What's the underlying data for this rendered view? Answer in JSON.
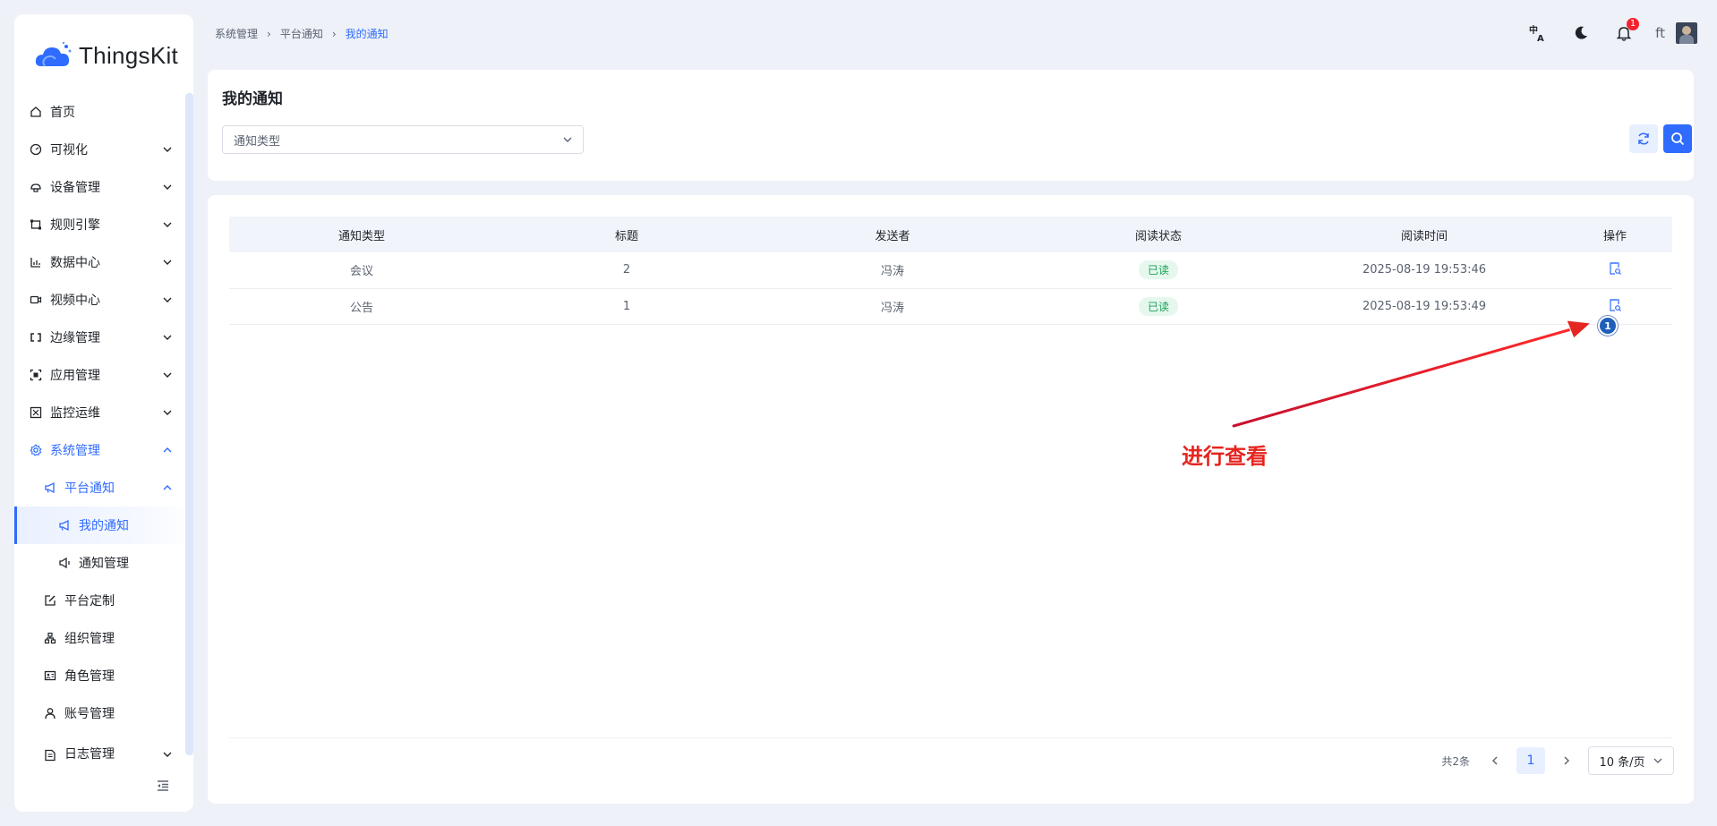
{
  "app": {
    "logo_text": "ThingsKit"
  },
  "sidebar": {
    "items": [
      {
        "label": "首页",
        "icon": "home-icon"
      },
      {
        "label": "可视化",
        "icon": "dashboard-icon"
      },
      {
        "label": "设备管理",
        "icon": "device-icon"
      },
      {
        "label": "规则引擎",
        "icon": "rule-icon"
      },
      {
        "label": "数据中心",
        "icon": "chart-icon"
      },
      {
        "label": "视频中心",
        "icon": "video-icon"
      },
      {
        "label": "边缘管理",
        "icon": "edge-icon"
      },
      {
        "label": "应用管理",
        "icon": "app-icon"
      },
      {
        "label": "监控运维",
        "icon": "monitor-icon"
      },
      {
        "label": "系统管理",
        "icon": "gear-icon"
      },
      {
        "label": "平台通知",
        "icon": "megaphone-icon"
      },
      {
        "label": "我的通知",
        "icon": "megaphone-icon"
      },
      {
        "label": "通知管理",
        "icon": "speaker-icon"
      },
      {
        "label": "平台定制",
        "icon": "edit-icon"
      },
      {
        "label": "组织管理",
        "icon": "org-icon"
      },
      {
        "label": "角色管理",
        "icon": "id-card-icon"
      },
      {
        "label": "账号管理",
        "icon": "user-icon"
      },
      {
        "label": "日志管理",
        "icon": "log-icon"
      }
    ]
  },
  "header": {
    "breadcrumb": [
      "系统管理",
      "平台通知",
      "我的通知"
    ],
    "notification_count": "1",
    "user_name": "ft"
  },
  "filter": {
    "title": "我的通知",
    "type_placeholder": "通知类型"
  },
  "table": {
    "columns": [
      "通知类型",
      "标题",
      "发送者",
      "阅读状态",
      "阅读时间",
      "操作"
    ],
    "rows": [
      {
        "type": "会议",
        "title": "2",
        "sender": "冯涛",
        "status": "已读",
        "time": "2025-08-19 19:53:46"
      },
      {
        "type": "公告",
        "title": "1",
        "sender": "冯涛",
        "status": "已读",
        "time": "2025-08-19 19:53:49"
      }
    ]
  },
  "pagination": {
    "total": "共2条",
    "current_page": "1",
    "page_size": "10 条/页"
  },
  "annotation": {
    "step": "1",
    "text": "进行查看"
  },
  "colors": {
    "primary": "#2f6bff",
    "annotation": "#e5251f",
    "read_tag": "#18a058"
  }
}
